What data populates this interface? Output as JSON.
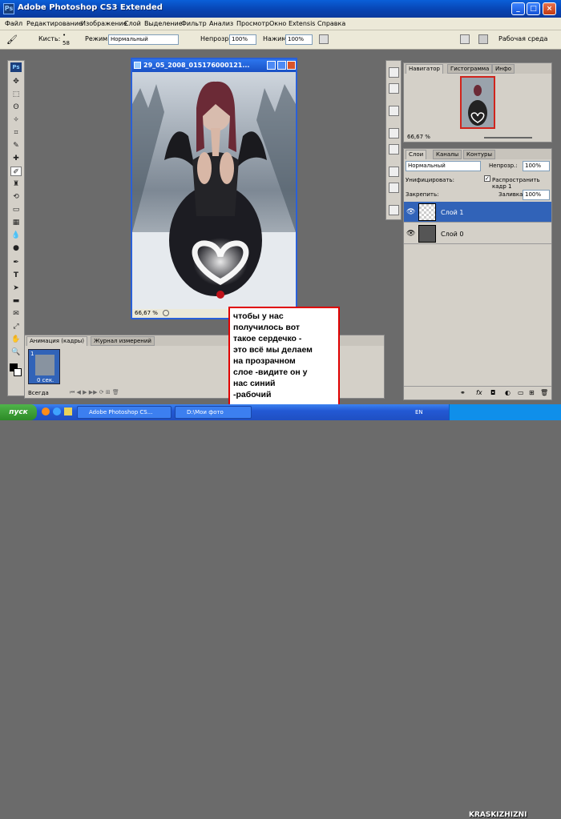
{
  "app": {
    "title": "Adobe Photoshop CS3 Extended",
    "logo": "Ps"
  },
  "menu": [
    "Файл",
    "Редактирование",
    "Изображение",
    "Слой",
    "Выделение",
    "Фильтр",
    "Анализ",
    "Просмотр",
    "Окно",
    "Extensis",
    "Справка"
  ],
  "options": {
    "brush_label": "Кисть:",
    "brush_size": "58",
    "mode_label": "Режим:",
    "mode_value": "Нормальный",
    "opacity_label": "Непрозр.:",
    "opacity_value": "100%",
    "flow_label": "Нажим:",
    "flow_value": "100%",
    "workspace": "Рабочая среда"
  },
  "document": {
    "title": "29_05_2008_015176000121...",
    "zoom": "66,67 %"
  },
  "navigator": {
    "tabs": [
      "Навигатор",
      "Гистограмма",
      "Инфо"
    ],
    "zoom": "66,67 %"
  },
  "layers": {
    "tabs": [
      "Слои",
      "Каналы",
      "Контуры"
    ],
    "blend": "Нормальный",
    "opacity_label": "Непрозр.:",
    "opacity": "100%",
    "unify_label": "Унифицировать:",
    "propagate_label": "Распространить кадр 1",
    "lock_label": "Закрепить:",
    "fill_label": "Заливка:",
    "fill": "100%",
    "items": [
      {
        "name": "Слой 1",
        "selected": true
      },
      {
        "name": "Слой 0",
        "selected": false
      }
    ]
  },
  "animation": {
    "tabs": [
      "Анимация (кадры)",
      "Журнал измерений"
    ],
    "frame_num": "1",
    "frame_time": "0 сек.",
    "loop": "Всегда"
  },
  "callout": "чтобы у нас\nполучилось вот\nтакое сердечко -\nэто всё мы делаем\nна прозрачном\nслое -видите он у\nнас синий\n-рабочий",
  "taskbar": {
    "start": "пуск",
    "tasks": [
      "Adobe Photoshop CS...",
      "D:\\Мои фото"
    ],
    "lang": "EN"
  },
  "watermark": "KRASKIZHIZNI",
  "colors": {
    "accent": "#2a60d8",
    "callout_border": "#e00000",
    "selected_layer": "#3163b8"
  }
}
